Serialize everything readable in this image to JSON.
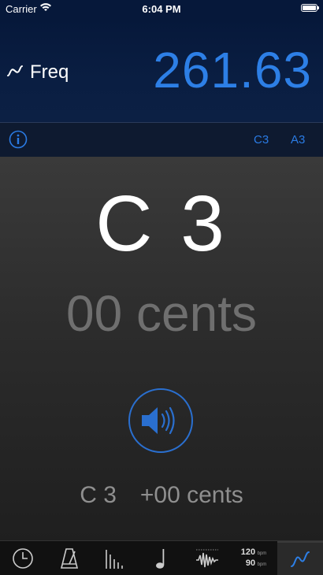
{
  "status": {
    "carrier": "Carrier",
    "time": "6:04 PM"
  },
  "header": {
    "mode_label": "Freq",
    "frequency": "261.63"
  },
  "subbar": {
    "note_c3": "C3",
    "note_a3": "A3"
  },
  "main": {
    "note": "C 3",
    "cents": "00 cents",
    "readout_note": "C 3",
    "readout_cents": "+00 cents"
  },
  "tabbar": {
    "bpm_top": "120",
    "bpm_bottom": "90",
    "bpm_unit": "bpm"
  },
  "colors": {
    "accent": "#2d7fe6",
    "header_bg": "#06183a"
  }
}
